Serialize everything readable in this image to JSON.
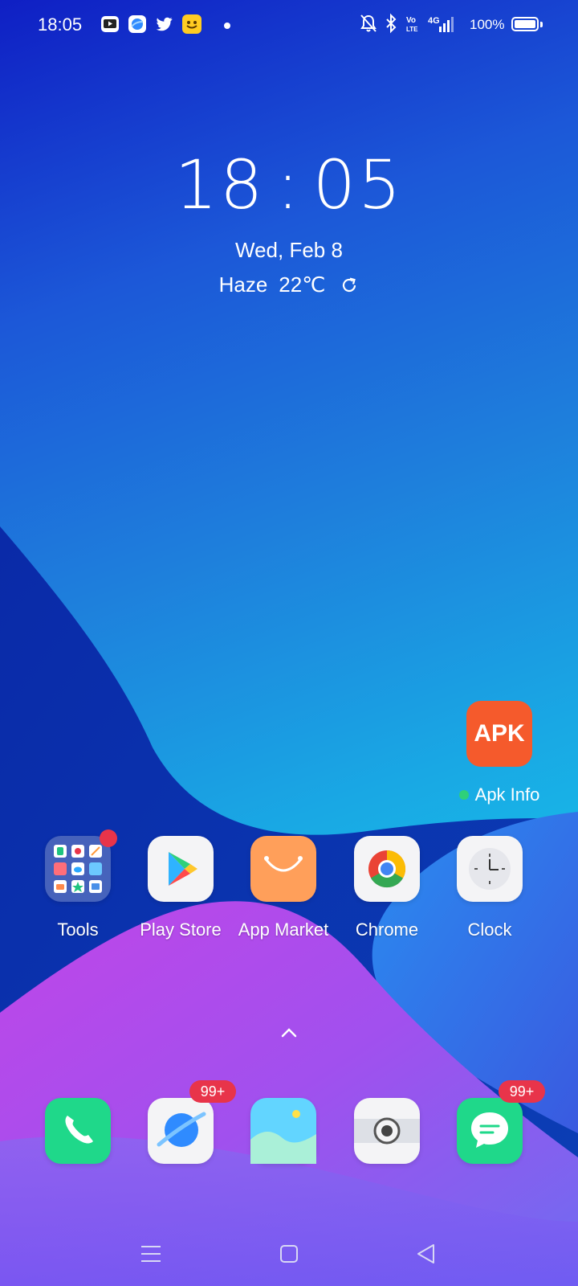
{
  "status_bar": {
    "time": "18:05",
    "notification_icons": [
      "youtube-icon",
      "browser-icon",
      "twitter-icon",
      "emoji-app-icon"
    ],
    "system_icons": [
      "mute-bell-icon",
      "bluetooth-icon",
      "volte-icon",
      "4g-signal-icon"
    ],
    "volte_label": "Vo LTE",
    "network_label": "4G",
    "battery_text": "100%",
    "battery_level": 1.0
  },
  "clock_widget": {
    "hours": "18",
    "minutes": "05",
    "date": "Wed, Feb 8",
    "weather_condition": "Haze",
    "temperature": "22℃"
  },
  "apk_widget": {
    "icon_text": "APK",
    "label": "Apk Info",
    "status_color": "#2ed07a"
  },
  "home_apps": [
    {
      "label": "Tools",
      "icon": "folder-icon"
    },
    {
      "label": "Play Store",
      "icon": "play-store-icon"
    },
    {
      "label": "App Market",
      "icon": "app-market-icon"
    },
    {
      "label": "Chrome",
      "icon": "chrome-icon"
    },
    {
      "label": "Clock",
      "icon": "clock-icon"
    }
  ],
  "dock": [
    {
      "icon": "phone-icon"
    },
    {
      "icon": "browser-icon",
      "badge": "99+"
    },
    {
      "icon": "gallery-icon"
    },
    {
      "icon": "camera-icon"
    },
    {
      "icon": "messages-icon",
      "badge": "99+"
    }
  ],
  "nav_bar": [
    "menu-icon",
    "home-icon",
    "back-icon"
  ],
  "colors": {
    "badge": "#e8344a",
    "apk": "#f55a2c",
    "phone": "#1fd88a",
    "messages": "#1fd88a",
    "app_market": "#ff9f5a"
  }
}
